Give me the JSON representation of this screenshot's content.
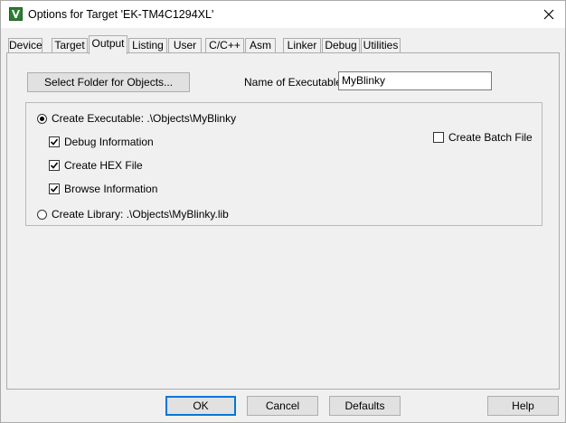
{
  "window": {
    "title": "Options for Target 'EK-TM4C1294XL'"
  },
  "tabs": [
    {
      "label": "Device",
      "active": false
    },
    {
      "label": "Target",
      "active": false
    },
    {
      "label": "Output",
      "active": true
    },
    {
      "label": "Listing",
      "active": false
    },
    {
      "label": "User",
      "active": false
    },
    {
      "label": "C/C++",
      "active": false
    },
    {
      "label": "Asm",
      "active": false
    },
    {
      "label": "Linker",
      "active": false
    },
    {
      "label": "Debug",
      "active": false
    },
    {
      "label": "Utilities",
      "active": false
    }
  ],
  "output": {
    "select_folder_label": "Select Folder for Objects...",
    "name_label": "Name of Executable:",
    "name_value": "MyBlinky",
    "create_executable_label": "Create Executable:  .\\Objects\\MyBlinky",
    "create_executable_selected": true,
    "debug_info_label": "Debug Information",
    "debug_info_checked": true,
    "create_hex_label": "Create HEX File",
    "create_hex_checked": true,
    "browse_info_label": "Browse Information",
    "browse_info_checked": true,
    "create_library_label": "Create Library:  .\\Objects\\MyBlinky.lib",
    "create_library_selected": false,
    "create_batch_label": "Create Batch File",
    "create_batch_checked": false
  },
  "footer": {
    "ok_label": "OK",
    "cancel_label": "Cancel",
    "defaults_label": "Defaults",
    "help_label": "Help"
  },
  "colors": {
    "accent": "#0078d7",
    "app_icon": "#2e7d32"
  }
}
